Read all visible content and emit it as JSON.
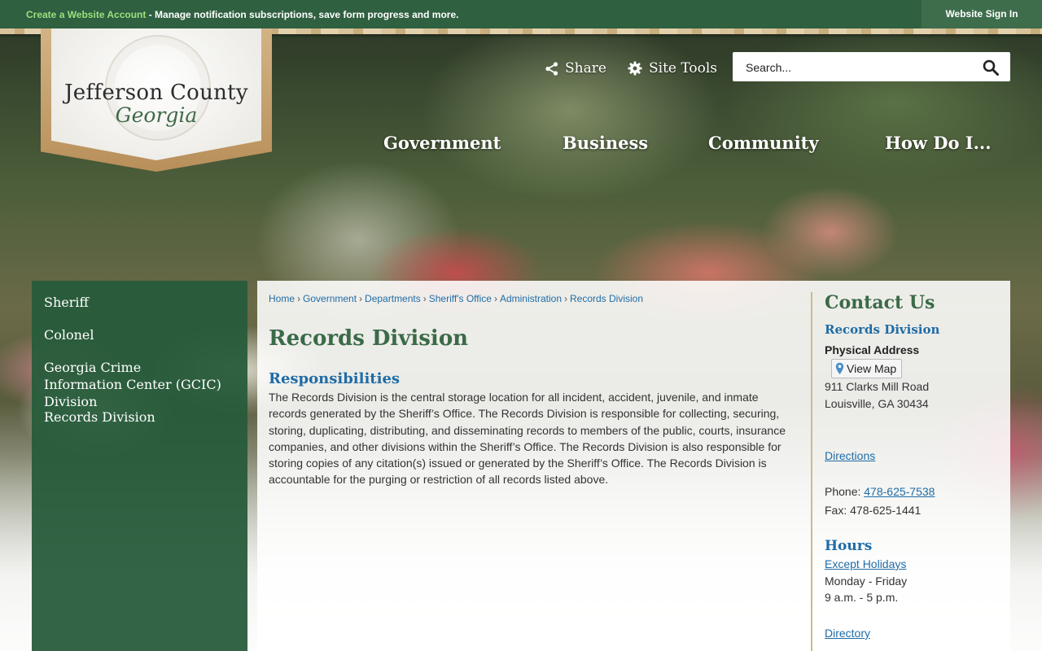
{
  "topbar": {
    "account_link": "Create a Website Account",
    "account_desc": " - Manage notification subscriptions, save form progress and more.",
    "signin": "Website Sign In"
  },
  "logo": {
    "title": "Jefferson County",
    "subtitle": "Georgia"
  },
  "tools": {
    "share": "Share",
    "site_tools": "Site Tools"
  },
  "search": {
    "placeholder": "Search..."
  },
  "nav": [
    "Government",
    "Business",
    "Community",
    "How Do I..."
  ],
  "sidebar": {
    "items": [
      "Sheriff",
      "Colonel",
      "Georgia Crime Information Center (GCIC) Division",
      "Records Division"
    ]
  },
  "breadcrumb": [
    "Home",
    "Government",
    "Departments",
    "Sheriff's Office",
    "Administration",
    "Records Division"
  ],
  "page": {
    "title": "Records Division",
    "subtitle": "Responsibilities",
    "body": "The Records Division is the central storage location for all incident, accident, juvenile, and inmate records generated by the Sheriff’s Office. The Records Division is responsible for collecting, securing, storing, duplicating, distributing, and disseminating records to members of the public, courts, insurance companies, and other divisions within the Sheriff’s Office. The Records Division is also responsible for storing copies of any citation(s) issued or generated by the Sheriff’s Office. The Records Division is accountable for the purging or restriction of all records listed above."
  },
  "contact": {
    "title": "Contact Us",
    "division": "Records Division",
    "address_label": "Physical Address",
    "view_map": "View Map",
    "street": "911 Clarks Mill Road",
    "city": "Louisville, GA 30434",
    "directions": "Directions",
    "phone_label": "Phone: ",
    "phone": "478-625-7538",
    "fax": "Fax: 478-625-1441",
    "hours_title": "Hours",
    "except_holidays": "Except Holidays",
    "days": "Monday - Friday",
    "time": "9 a.m. - 5 p.m.",
    "directory": "Directory"
  },
  "colors": {
    "topbar": "#2f6040",
    "accent_green": "#3b6a48",
    "link_blue": "#1f6ca6",
    "sidebar": "#275c3b"
  }
}
